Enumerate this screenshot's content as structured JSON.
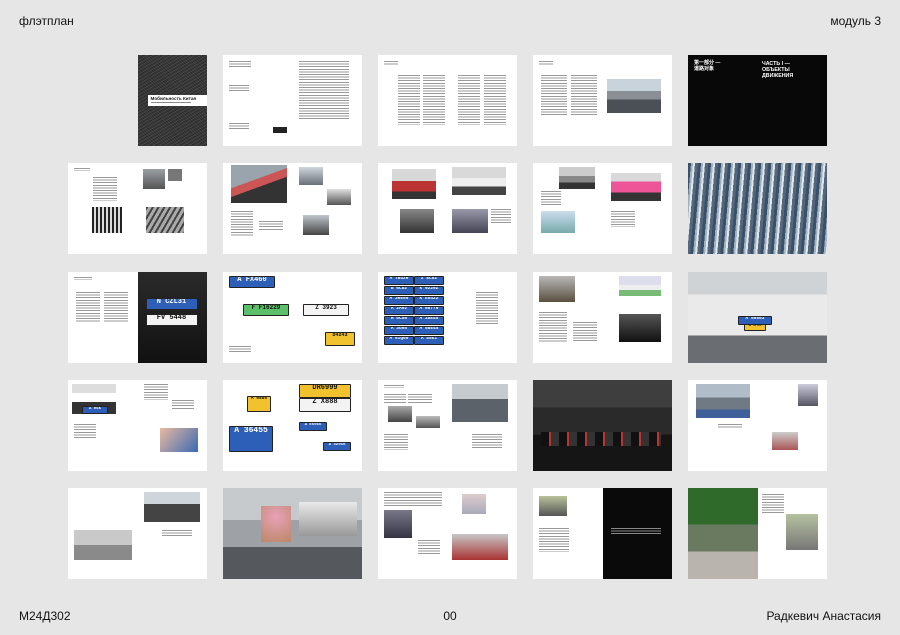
{
  "header": {
    "left": "флэтплан",
    "right": "модуль 3"
  },
  "footer": {
    "left": "М24Д302",
    "center": "00",
    "right": "Радкевич Анастасия"
  },
  "cover": {
    "title": "Мобильность Китая"
  },
  "part_spread": {
    "chinese": "第一部分 —\n道路对象",
    "russian": "ЧАСТЬ I —\nОБЪЕКТЫ\nДВИЖЕНИЯ"
  },
  "plates": {
    "r3s1": [
      "A FX460",
      "F F16229",
      "Z 3923",
      "D4243"
    ],
    "r3s0": [
      "N CZL31",
      "FV 5448"
    ],
    "r3s2": [
      "A 7B426",
      "Z 8C82",
      "B 6C82",
      "K 9229Z",
      "A 30E66",
      "K E5422",
      "A 2A92",
      "A 08779",
      "H 0C56",
      "A 28E45",
      "A 3U65",
      "A 58E45",
      "A 61Q00",
      "A 45E1"
    ],
    "r3s4": [
      "A 99593",
      "A 9F96"
    ],
    "r4s1": [
      "A 9885",
      "DR6999",
      "Z X888",
      "A 36455",
      "A E6056",
      "A 32960"
    ],
    "r4s0": [
      "A 05K"
    ]
  }
}
